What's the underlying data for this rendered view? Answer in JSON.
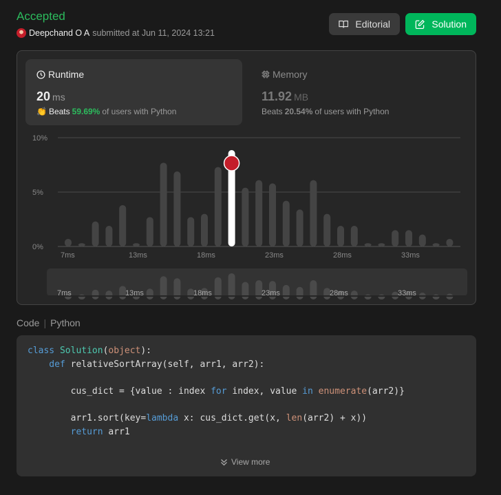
{
  "status": "Accepted",
  "submitter": {
    "name": "Deepchand O A",
    "text": "submitted at Jun 11, 2024 13:21"
  },
  "buttons": {
    "editorial": "Editorial",
    "solution": "Solution"
  },
  "runtime": {
    "title": "Runtime",
    "value": "20",
    "unit": "ms",
    "beats": "Beats",
    "percent": "59.69%",
    "suffix": "of users with Python"
  },
  "memory": {
    "title": "Memory",
    "value": "11.92",
    "unit": "MB",
    "beats": "Beats",
    "percent": "20.54%",
    "suffix": "of users with Python"
  },
  "colors": {
    "accent": "#2cbb5d",
    "solution_btn": "#00b65b",
    "bar": "#444444",
    "highlight": "#ffffff"
  },
  "chart_data": {
    "type": "bar",
    "ylabel_ticks": [
      "0%",
      "5%",
      "10%"
    ],
    "ylim": [
      0,
      10
    ],
    "x_tick_labels": [
      "7ms",
      "13ms",
      "18ms",
      "23ms",
      "28ms",
      "33ms"
    ],
    "x_tick_indices": [
      0,
      5,
      10,
      15,
      20,
      25
    ],
    "values": [
      0.7,
      0.3,
      2.3,
      1.9,
      3.8,
      0.3,
      2.7,
      7.7,
      6.9,
      2.7,
      3.0,
      7.3,
      8.9,
      5.4,
      6.1,
      5.8,
      4.2,
      3.4,
      6.1,
      3.0,
      1.9,
      1.9,
      0.3,
      0.3,
      1.5,
      1.5,
      1.1,
      0.3,
      0.7
    ],
    "highlight_index": 12,
    "grid": true
  },
  "code": {
    "label": "Code",
    "language": "Python",
    "lines": [
      [
        [
          "class ",
          "kw"
        ],
        [
          "Solution",
          "cl"
        ],
        [
          "(",
          ""
        ],
        [
          "object",
          "bi"
        ],
        [
          "):",
          ""
        ]
      ],
      [
        [
          "    def ",
          "kw"
        ],
        [
          "relativeSortArray(self, arr1, arr2):",
          ""
        ]
      ],
      [],
      [
        [
          "        cus_dict = {value : index ",
          ""
        ],
        [
          "for",
          "kw"
        ],
        [
          " index, value ",
          ""
        ],
        [
          "in",
          "kw"
        ],
        [
          " ",
          ""
        ],
        [
          "enumerate",
          "bi"
        ],
        [
          "(arr2)}",
          ""
        ]
      ],
      [],
      [
        [
          "        arr1.sort(key=",
          ""
        ],
        [
          "lambda",
          "kw"
        ],
        [
          " x: cus_dict.get(x, ",
          ""
        ],
        [
          "len",
          "bi"
        ],
        [
          "(arr2) + x))",
          ""
        ]
      ],
      [
        [
          "        ",
          ""
        ],
        [
          "return",
          "kw"
        ],
        [
          " arr1",
          ""
        ]
      ]
    ],
    "view_more": "View more"
  }
}
